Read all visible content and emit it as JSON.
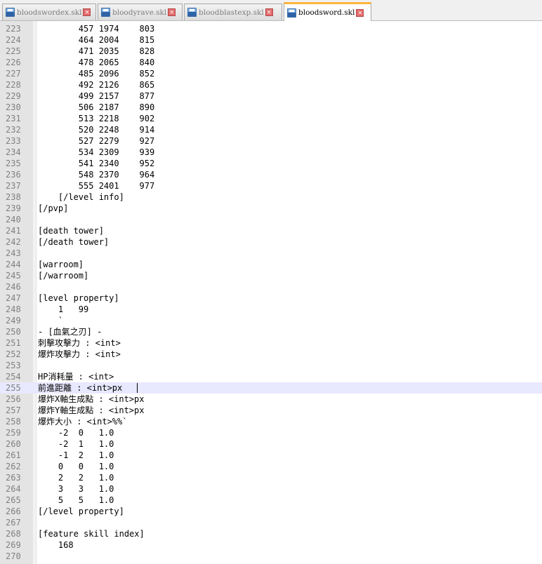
{
  "tabs": [
    {
      "label": "bloodswordex.skl",
      "active": false
    },
    {
      "label": "bloodyrave.skl",
      "active": false
    },
    {
      "label": "bloodblastexp.skl",
      "active": false
    },
    {
      "label": "bloodsword.skl",
      "active": true
    }
  ],
  "tab_close_glyph": "×",
  "colors": {
    "active_tab_accent": "#ffb43c",
    "current_line": "#e8e8ff",
    "line_number": "#808080"
  },
  "current_line": 255,
  "lines": [
    {
      "n": "223",
      "text": "        457 1974    803"
    },
    {
      "n": "224",
      "text": "        464 2004    815"
    },
    {
      "n": "225",
      "text": "        471 2035    828"
    },
    {
      "n": "226",
      "text": "        478 2065    840"
    },
    {
      "n": "227",
      "text": "        485 2096    852"
    },
    {
      "n": "228",
      "text": "        492 2126    865"
    },
    {
      "n": "229",
      "text": "        499 2157    877"
    },
    {
      "n": "230",
      "text": "        506 2187    890"
    },
    {
      "n": "231",
      "text": "        513 2218    902"
    },
    {
      "n": "232",
      "text": "        520 2248    914"
    },
    {
      "n": "233",
      "text": "        527 2279    927"
    },
    {
      "n": "234",
      "text": "        534 2309    939"
    },
    {
      "n": "235",
      "text": "        541 2340    952"
    },
    {
      "n": "236",
      "text": "        548 2370    964"
    },
    {
      "n": "237",
      "text": "        555 2401    977"
    },
    {
      "n": "238",
      "text": "    [/level info]"
    },
    {
      "n": "239",
      "text": "[/pvp]"
    },
    {
      "n": "240",
      "text": ""
    },
    {
      "n": "241",
      "text": "[death tower]"
    },
    {
      "n": "242",
      "text": "[/death tower]"
    },
    {
      "n": "243",
      "text": ""
    },
    {
      "n": "244",
      "text": "[warroom]"
    },
    {
      "n": "245",
      "text": "[/warroom]"
    },
    {
      "n": "246",
      "text": ""
    },
    {
      "n": "247",
      "text": "[level property]"
    },
    {
      "n": "248",
      "text": "    1   99"
    },
    {
      "n": "249",
      "text": "    `"
    },
    {
      "n": "250",
      "text": "- [血氣之刃] -"
    },
    {
      "n": "251",
      "text": "刺擊攻擊力 : <int>"
    },
    {
      "n": "252",
      "text": "爆炸攻擊力 : <int>"
    },
    {
      "n": "253",
      "text": ""
    },
    {
      "n": "254",
      "text": "HP消耗量 : <int>"
    },
    {
      "n": "255",
      "text": "前進距離 : <int>px"
    },
    {
      "n": "256",
      "text": "爆炸X軸生成點 : <int>px"
    },
    {
      "n": "257",
      "text": "爆炸Y軸生成點 : <int>px"
    },
    {
      "n": "258",
      "text": "爆炸大小 : <int>%%`"
    },
    {
      "n": "259",
      "text": "    -2  0   1.0"
    },
    {
      "n": "260",
      "text": "    -2  1   1.0"
    },
    {
      "n": "261",
      "text": "    -1  2   1.0"
    },
    {
      "n": "262",
      "text": "    0   0   1.0"
    },
    {
      "n": "263",
      "text": "    2   2   1.0"
    },
    {
      "n": "264",
      "text": "    3   3   1.0"
    },
    {
      "n": "265",
      "text": "    5   5   1.0"
    },
    {
      "n": "266",
      "text": "[/level property]"
    },
    {
      "n": "267",
      "text": ""
    },
    {
      "n": "268",
      "text": "[feature skill index]"
    },
    {
      "n": "269",
      "text": "    168"
    },
    {
      "n": "270",
      "text": ""
    }
  ]
}
